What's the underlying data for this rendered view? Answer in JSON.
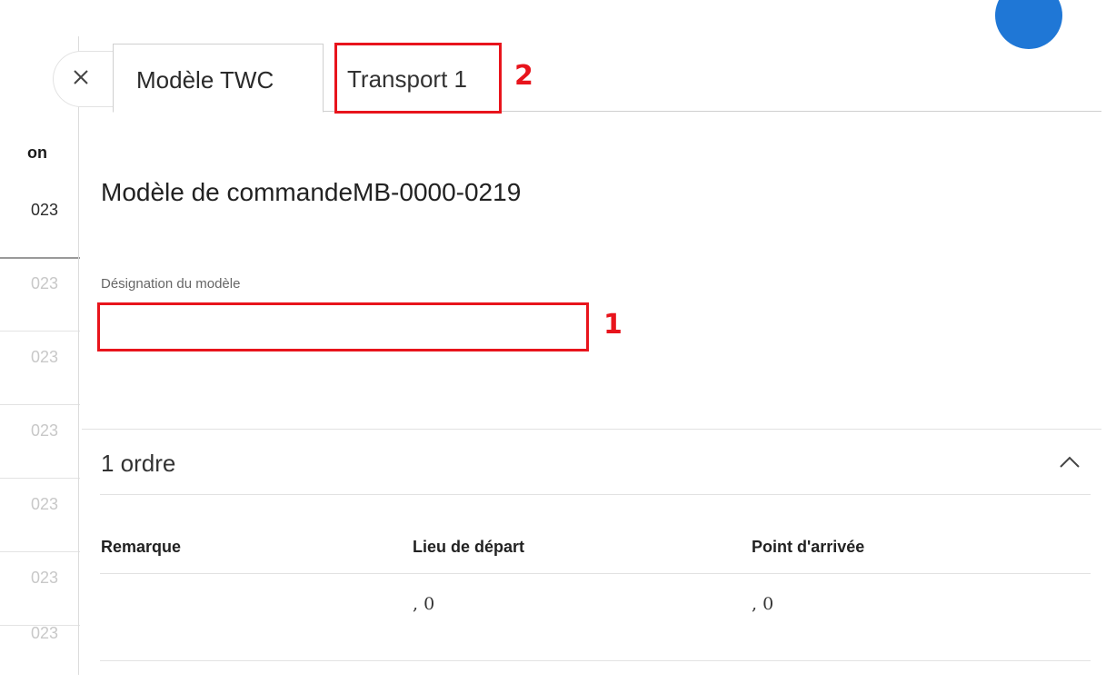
{
  "left_list": {
    "header": "on",
    "rows": [
      "023",
      "023",
      "023",
      "023",
      "023",
      "023",
      "023"
    ]
  },
  "tabs": {
    "close_icon": "close-icon",
    "active_label": "Modèle TWC",
    "second_label": "Transport 1"
  },
  "annotations": {
    "marker_1": "1",
    "marker_2": "2",
    "color": "#e8141c"
  },
  "form": {
    "title": "Modèle de commandeMB-0000-0219",
    "designation_label": "Désignation du modèle",
    "designation_value": ""
  },
  "orders": {
    "section_title": "1 ordre",
    "toggle_icon": "chevron-up-icon",
    "columns": [
      "Remarque",
      "Lieu de départ",
      "Point d'arrivée"
    ],
    "rows": [
      [
        "",
        ", 0",
        ", 0"
      ]
    ]
  },
  "colors": {
    "avatar": "#1f77d6",
    "annotation_red": "#e8141c"
  }
}
